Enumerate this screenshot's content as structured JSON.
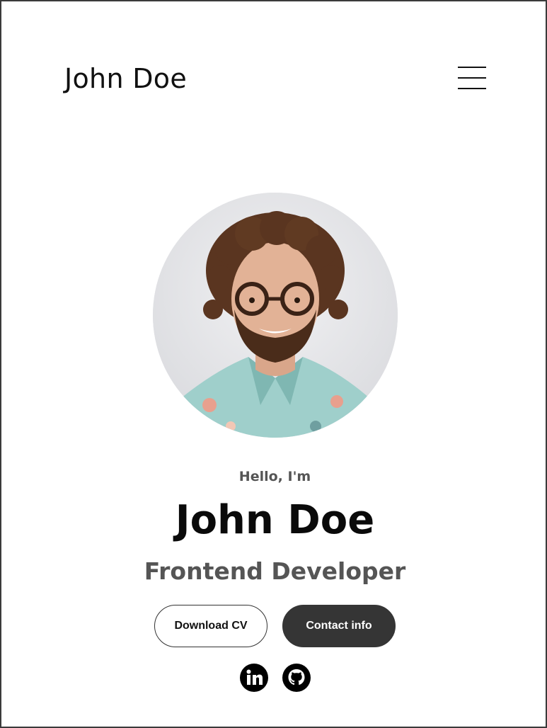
{
  "header": {
    "logo_text": "John Doe",
    "menu_icon": "hamburger-menu-icon"
  },
  "hero": {
    "greeting": "Hello, I'm",
    "name": "John Doe",
    "title": "Frontend Developer",
    "photo_alt": "profile-photo"
  },
  "actions": {
    "download_cv_label": "Download CV",
    "contact_info_label": "Contact info"
  },
  "socials": [
    {
      "name": "linkedin",
      "icon": "linkedin-icon"
    },
    {
      "name": "github",
      "icon": "github-icon"
    }
  ],
  "colors": {
    "text_primary": "#0a0a0a",
    "text_secondary": "#555555",
    "button_dark": "#353535",
    "background": "#ffffff"
  }
}
